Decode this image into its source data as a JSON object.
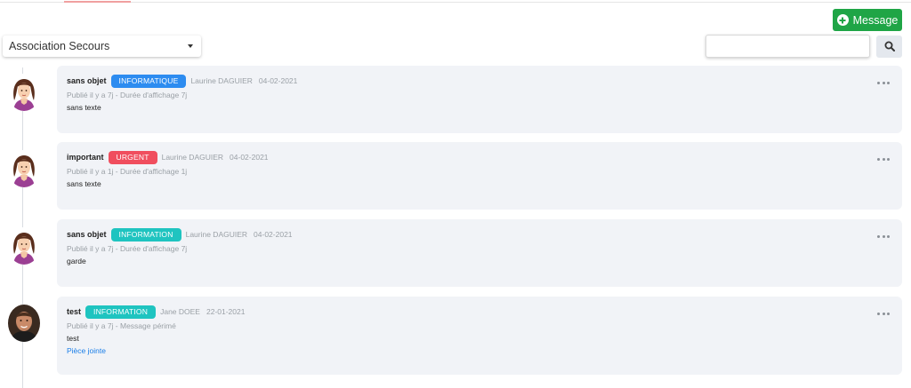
{
  "header": {
    "message_button_label": "Message",
    "association_select": {
      "selected": "Association Secours"
    },
    "search": {
      "value": "",
      "placeholder": ""
    }
  },
  "colors": {
    "primary_button": "#1fa546",
    "badge_informatique": "#2d8cf0",
    "badge_urgent": "#f04e5e",
    "badge_information": "#1fc4c0",
    "card_background": "#f1f3f7",
    "link": "#1a7ee8"
  },
  "icons": {
    "message_button": "plus-circle-icon",
    "search_button": "search-icon",
    "select": "caret-down-icon",
    "card_menu": "ellipsis-icon"
  },
  "messages": [
    {
      "subject": "sans objet",
      "badge": "INFORMATIQUE",
      "badge_color": "#2d8cf0",
      "author": "Laurine DAGUIER",
      "date": "04-02-2021",
      "meta": "Publié il y a 7j - Durée d'affichage 7j",
      "body": "sans texte",
      "avatar": "female-avatar"
    },
    {
      "subject": "important",
      "badge": "URGENT",
      "badge_color": "#f04e5e",
      "author": "Laurine DAGUIER",
      "date": "04-02-2021",
      "meta": "Publié il y a 1j - Durée d'affichage 1j",
      "body": "sans texte",
      "avatar": "female-avatar"
    },
    {
      "subject": "sans objet",
      "badge": "INFORMATION",
      "badge_color": "#1fc4c0",
      "author": "Laurine DAGUIER",
      "date": "04-02-2021",
      "meta": "Publié il y a 7j - Durée d'affichage 7j",
      "body": "garde",
      "avatar": "female-avatar"
    },
    {
      "subject": "test",
      "badge": "INFORMATION",
      "badge_color": "#1fc4c0",
      "author": "Jane DOEE",
      "date": "22-01-2021",
      "meta": "Publié il y a 7j - Message périmé",
      "body": "test",
      "attachment": "Pièce jointe",
      "avatar": "male-photo-avatar"
    }
  ]
}
